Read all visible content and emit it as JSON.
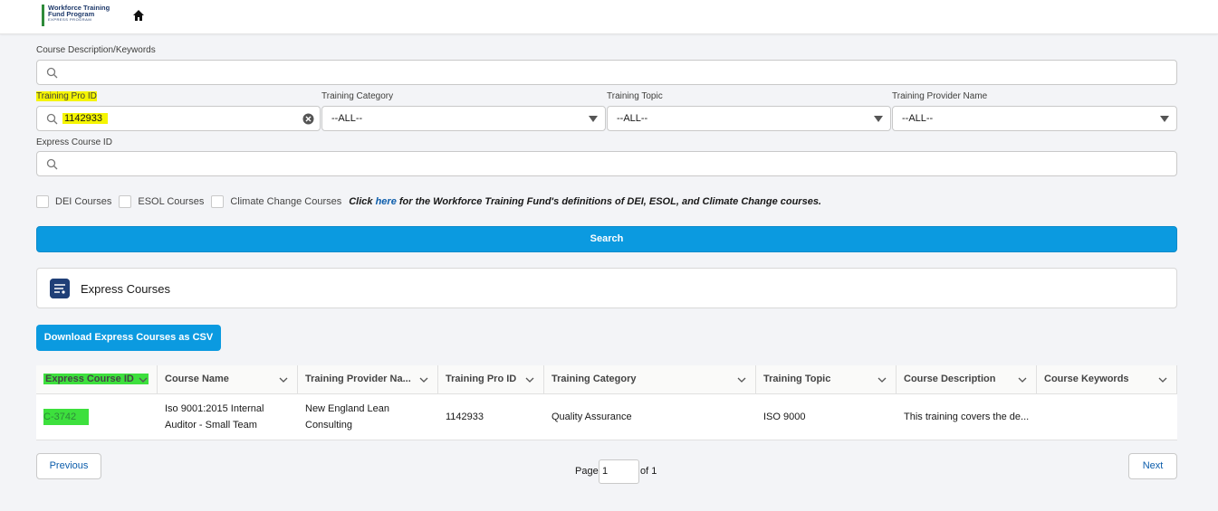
{
  "header": {
    "logo_line1": "Workforce Training",
    "logo_line2": "Fund Program",
    "logo_line3": "EXPRESS PROGRAM",
    "home_icon": "home-icon"
  },
  "filters": {
    "keywords_label": "Course Description/Keywords",
    "keywords_value": "",
    "training_pro_id_label": "Training Pro ID",
    "training_pro_id_value": "1142933",
    "training_category_label": "Training Category",
    "training_category_value": "--ALL--",
    "training_topic_label": "Training Topic",
    "training_topic_value": "--ALL--",
    "training_provider_label": "Training Provider Name",
    "training_provider_value": "--ALL--",
    "express_course_id_label": "Express Course ID",
    "express_course_id_value": ""
  },
  "checkboxes": [
    {
      "label": "DEI Courses",
      "checked": false
    },
    {
      "label": "ESOL Courses",
      "checked": false
    },
    {
      "label": "Climate Change Courses",
      "checked": false
    }
  ],
  "note": {
    "prefix": "Click",
    "link": "here",
    "suffix": "for the Workforce Training Fund's definitions of DEI, ESOL, and Climate Change courses."
  },
  "search_button": "Search",
  "card_title": "Express Courses",
  "csv_button": "Download Express Courses as CSV",
  "table": {
    "columns": [
      "Express Course ID",
      "Course Name",
      "Training Provider Na...",
      "Training Pro ID",
      "Training Category",
      "Training Topic",
      "Course Description",
      "Course Keywords"
    ],
    "rows": [
      {
        "express_course_id": "C-3742",
        "course_name_1": "Iso 9001:2015 Internal",
        "course_name_2": "Auditor - Small Team",
        "provider_1": "New England Lean",
        "provider_2": "Consulting",
        "training_pro_id": "1142933",
        "category": "Quality Assurance",
        "topic": "ISO 9000",
        "description": "This training covers the de...",
        "keywords": ""
      }
    ]
  },
  "pagination": {
    "previous": "Previous",
    "page_label": "Page",
    "page_value": "1",
    "of_label": "of 1",
    "next": "Next"
  },
  "colors": {
    "primary_button": "#0b9ae0",
    "highlight_yellow": "#f5f500",
    "highlight_green": "#3de03d",
    "link": "#0b5cab"
  }
}
